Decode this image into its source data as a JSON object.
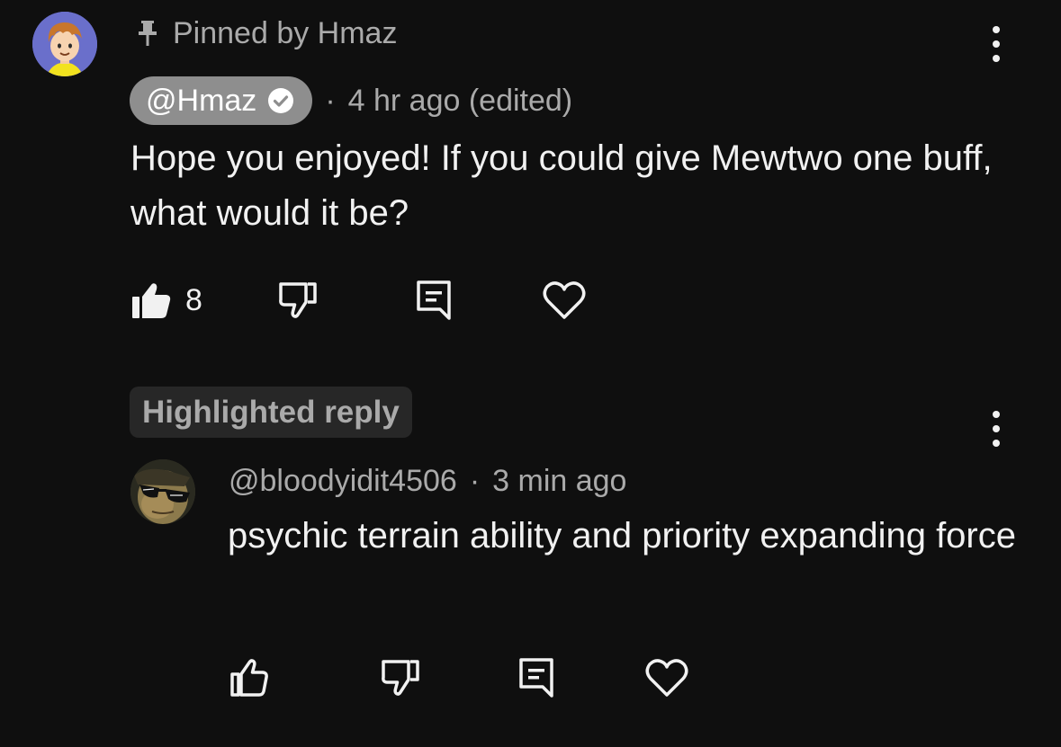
{
  "pinned_comment": {
    "pinned_label": "Pinned by Hmaz",
    "author": "@Hmaz",
    "separator": "·",
    "timestamp": "4 hr ago (edited)",
    "text": "Hope you enjoyed! If you could give Mewtwo one buff, what would it be?",
    "like_count": "8",
    "icons": {
      "pin": "pin-icon",
      "verified": "verified-check-icon",
      "like": "thumbs-up-filled-icon",
      "dislike": "thumbs-down-icon",
      "reply": "reply-icon",
      "heart": "heart-icon",
      "more": "more-vertical-icon"
    }
  },
  "highlighted_reply": {
    "badge_label": "Highlighted reply",
    "author": "@bloodyidit4506",
    "separator": "·",
    "timestamp": "3 min ago",
    "text": "psychic terrain ability and priority expanding force",
    "icons": {
      "like": "thumbs-up-outline-icon",
      "dislike": "thumbs-down-icon",
      "reply": "reply-icon",
      "heart": "heart-icon",
      "more": "more-vertical-icon"
    }
  },
  "colors": {
    "background": "#0f0f0f",
    "primary_text": "#f1f1f1",
    "secondary_text": "#aaaaaa",
    "author_chip": "#8e8e8e",
    "badge_background": "#272727"
  }
}
